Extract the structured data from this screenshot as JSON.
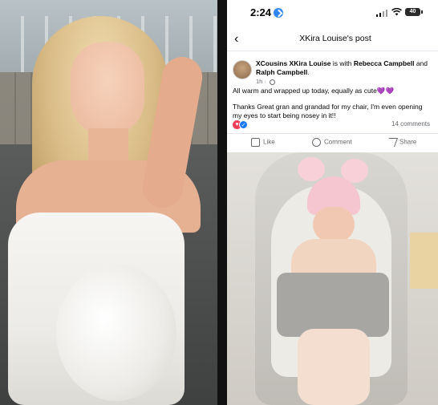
{
  "status_bar": {
    "time": "2:24",
    "battery": "40"
  },
  "nav": {
    "title": "XKira Louise's post"
  },
  "post": {
    "author_line_prefix": "XCousins XKira Louise",
    "author_line_with": " is with ",
    "tagged_1": "Rebecca Campbell",
    "and_text": " and ",
    "tagged_2": "Ralph Campbell",
    "period": ".",
    "time_ago": "1h ·",
    "text_line_1": "All warm and wrapped up today, equally as cute💜💜",
    "text_line_2": "Thanks Great gran and grandad for my chair, I'm even opening my eyes to start being nosey in it!!",
    "comments_count": "14 comments"
  },
  "actions": {
    "like_label": "Like",
    "comment_label": "Comment",
    "share_label": "Share"
  },
  "icons": {
    "back": "chevron-left-icon",
    "location": "location-arrow-icon",
    "signal": "signal-icon",
    "wifi": "wifi-icon",
    "battery": "battery-icon",
    "globe": "globe-icon",
    "love_reaction": "heart-reaction-icon",
    "like_reaction": "thumbs-up-reaction-icon"
  },
  "colors": {
    "facebook_blue": "#1877f2",
    "love_red": "#f33e58",
    "secondary_text": "#65676b"
  }
}
